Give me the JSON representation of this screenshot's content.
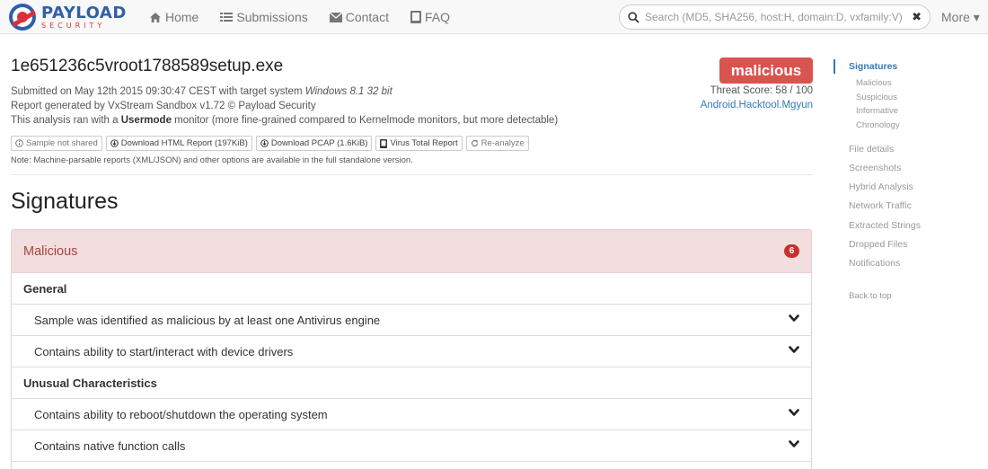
{
  "brand": {
    "name": "PAYLOAD",
    "sub": "SECURITY"
  },
  "nav": {
    "links": [
      {
        "label": "Home",
        "icon": "home-icon"
      },
      {
        "label": "Submissions",
        "icon": "list-icon"
      },
      {
        "label": "Contact",
        "icon": "envelope-icon"
      },
      {
        "label": "FAQ",
        "icon": "book-icon"
      }
    ],
    "search_placeholder": "Search (MD5, SHA256, host:H, domain:D, vxfamily:V) ...",
    "search_clear": "✖",
    "more_label": "More ▾"
  },
  "report": {
    "filename": "1e651236c5vroot1788589setup.exe",
    "submitted_prefix": "Submitted on May 12th 2015 09:30:47 CEST with target system ",
    "target_system": "Windows 8.1 32 bit",
    "generated_by": "Report generated by VxStream Sandbox v1.72 © Payload Security",
    "mode_prefix": "This analysis ran with a ",
    "mode": "Usermode",
    "mode_suffix": " monitor (more fine-grained compared to Kernelmode monitors, but more detectable)",
    "buttons": [
      {
        "label": "Sample not shared",
        "icon": "info-circle-icon"
      },
      {
        "label": "Download HTML Report (197KiB)",
        "icon": "download-circle-icon"
      },
      {
        "label": "Download PCAP (1.6KiB)",
        "icon": "download-circle-icon"
      },
      {
        "label": "Virus Total Report",
        "icon": "book-icon"
      },
      {
        "label": "Re-analyze",
        "icon": "refresh-icon"
      }
    ],
    "note": "Note: Machine-parsable reports (XML/JSON) and other options are available in the full standalone version.",
    "verdict": "malicious",
    "threat_score": "Threat Score: 58 / 100",
    "family": "Android.Hacktool.Mgyun"
  },
  "signatures": {
    "title": "Signatures",
    "panel_title": "Malicious",
    "count": "6",
    "groups": [
      {
        "label": "General",
        "items": [
          "Sample was identified as malicious by at least one Antivirus engine",
          "Contains ability to start/interact with device drivers"
        ]
      },
      {
        "label": "Unusual Characteristics",
        "items": [
          "Contains ability to reboot/shutdown the operating system",
          "Contains native function calls"
        ]
      }
    ]
  },
  "sidebar": {
    "items": [
      {
        "label": "Signatures",
        "active": true
      },
      {
        "label": "Malicious",
        "sub": true
      },
      {
        "label": "Suspicious",
        "sub": true
      },
      {
        "label": "Informative",
        "sub": true
      },
      {
        "label": "Chronology",
        "sub": true
      },
      {
        "label": "File details"
      },
      {
        "label": "Screenshots"
      },
      {
        "label": "Hybrid Analysis"
      },
      {
        "label": "Network Traffic"
      },
      {
        "label": "Extracted Strings"
      },
      {
        "label": "Dropped Files"
      },
      {
        "label": "Notifications"
      }
    ],
    "back_to_top": "Back to top"
  },
  "colors": {
    "brand_blue": "#2f5fa8",
    "brand_red": "#d9303a",
    "danger": "#d9534f",
    "link": "#337ab7",
    "panel_bg": "#f2dede"
  }
}
